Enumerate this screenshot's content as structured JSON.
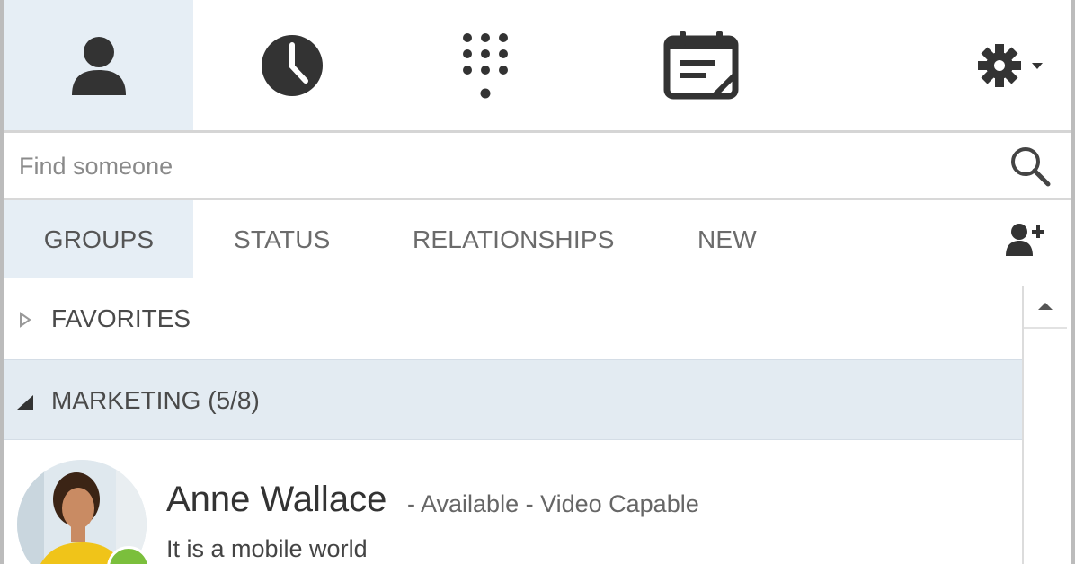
{
  "nav": {
    "tabs": [
      {
        "id": "contacts",
        "icon": "person-icon",
        "active": true
      },
      {
        "id": "conversations",
        "icon": "clock-icon",
        "active": false
      },
      {
        "id": "phone",
        "icon": "dialpad-icon",
        "active": false
      },
      {
        "id": "meetings",
        "icon": "calendar-icon",
        "active": false
      }
    ],
    "options_icon": "gear-icon"
  },
  "search": {
    "placeholder": "Find someone",
    "value": ""
  },
  "subtabs": [
    {
      "label": "GROUPS",
      "active": true
    },
    {
      "label": "STATUS",
      "active": false
    },
    {
      "label": "RELATIONSHIPS",
      "active": false
    },
    {
      "label": "NEW",
      "active": false
    }
  ],
  "groups": [
    {
      "label": "FAVORITES",
      "expanded": false
    },
    {
      "label": "MARKETING (5/8)",
      "expanded": true
    }
  ],
  "contact": {
    "name": "Anne Wallace",
    "status": "- Available - Video Capable",
    "note": "It is a mobile world",
    "presence_color": "#7bbf3c"
  },
  "colors": {
    "accent_active_tab": "#e6eef5",
    "group_header_bg": "#e3ebf2",
    "icon_dark": "#333333"
  }
}
